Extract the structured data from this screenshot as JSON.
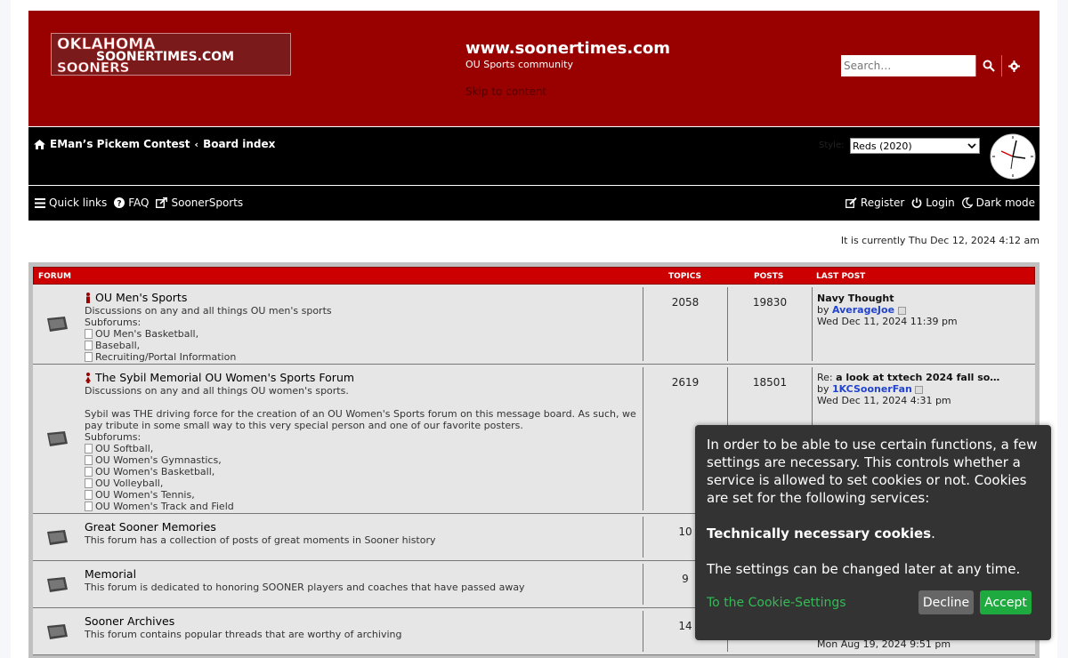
{
  "header": {
    "site_title": "www.soonertimes.com",
    "site_desc": "OU Sports community",
    "skip": "Skip to content",
    "search_placeholder": "Search…",
    "logo_text_1": "OKLAHOMA",
    "logo_text_2": "SOONERTIMES.COM",
    "logo_text_3": "SOONERS"
  },
  "breadcrumbs": {
    "home": "EMan’s Pickem Contest",
    "board": "Board index"
  },
  "style_switch": {
    "label": "Style:",
    "selected": "Reds (2020)"
  },
  "nav": {
    "quick_links": "Quick links",
    "faq": "FAQ",
    "sooner_sports": "SoonerSports",
    "register": "Register",
    "login": "Login",
    "dark_mode": "Dark mode"
  },
  "current_time": "It is currently Thu Dec 12, 2024 4:12 am",
  "forum_table": {
    "headers": {
      "forum": "FORUM",
      "topics": "TOPICS",
      "posts": "POSTS",
      "last_post": "LAST POST"
    },
    "subforums_label": "Subforums:",
    "rows": [
      {
        "title": "OU Men's Sports",
        "desc": "Discussions on any and all things OU men's sports",
        "subforums": [
          "OU Men's Basketball,",
          "Baseball,",
          "Recruiting/Portal Information"
        ],
        "topics": "2058",
        "posts": "19830",
        "last_title": "Navy Thought",
        "last_by": "by",
        "last_user": "AverageJoe",
        "last_date": "Wed Dec 11, 2024 11:39 pm"
      },
      {
        "title": "The Sybil Memorial OU Women's Sports Forum",
        "desc": "Discussions on any and all things OU women's sports.",
        "desc2": "Sybil was THE driving force for the creation of an OU Women's Sports forum on this message board. As such, we pay tribute in some small way to this very special person and one of our favorite posters.",
        "subforums": [
          "OU Softball,",
          "OU Women's Gymnastics,",
          "OU Women's Basketball,",
          "OU Volleyball,",
          "OU Women's Tennis,",
          "OU Women's Track and Field"
        ],
        "topics": "2619",
        "posts": "18501",
        "last_title_prefix": "Re:",
        "last_title": "a look at txtech 2024 fall so…",
        "last_by": "by",
        "last_user": "1KCSoonerFan",
        "last_date": "Wed Dec 11, 2024 4:31 pm"
      },
      {
        "title": "Great Sooner Memories",
        "desc": "This forum has a collection of posts of great moments in Sooner history",
        "topics": "10"
      },
      {
        "title": "Memorial",
        "desc": "This forum is dedicated to honoring SOONER players and coaches that have passed away",
        "topics": "9"
      },
      {
        "title": "Sooner Archives",
        "desc": "This forum contains popular threads that are worthy of archiving",
        "topics": "14",
        "last_date": "Mon Aug 19, 2024 9:51 pm"
      }
    ]
  },
  "cookie": {
    "text": "In order to be able to use certain functions, a few settings are necessary. This controls whether a service is allowed to set cookies or not. Cookies are set for the following services:",
    "necessary": "Technically necessary cookies",
    "necessary_suffix": ".",
    "later": "The settings can be changed later at any time.",
    "settings_link": "To the Cookie-Settings",
    "decline": "Decline",
    "accept": "Accept"
  },
  "colors": {
    "brand_red": "#990000",
    "header_bar": "#cc0000",
    "accept_green": "#1faa3f",
    "link_green": "#33bb55",
    "user_blue": "#2244cc"
  }
}
